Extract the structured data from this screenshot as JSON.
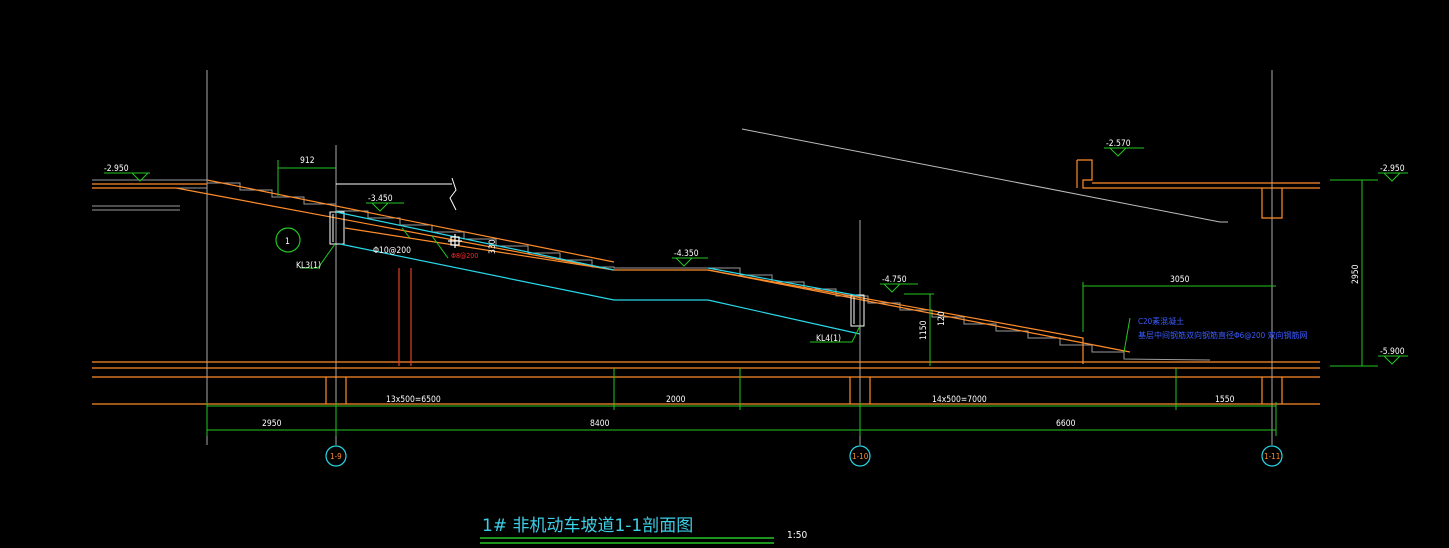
{
  "drawing": {
    "title": "1# 非机动车坡道1-1剖面图",
    "scale": "1:50",
    "elevations": {
      "left_top": "-2.950",
      "mid_upper": "-3.450",
      "mid_landing": "-4.350",
      "right_lower": "-4.750",
      "right_top_slab": "-2.570",
      "right_top": "-2.950",
      "right_bottom": "-5.900"
    },
    "dimensions": {
      "d912": "912",
      "d2950_vert": "2950",
      "d3050": "3050",
      "d1150": "1150",
      "d120": "120",
      "d330": "330",
      "steps_left": "13x500=6500",
      "landing": "2000",
      "steps_right": "14x500=7000",
      "d1550": "1550",
      "bay_left": "2950",
      "bay_mid": "8400",
      "bay_right": "6600"
    },
    "beams": {
      "kl3": "KL3(1)",
      "kl4": "KL4(1)"
    },
    "rebar": {
      "r1": "Φ10@200",
      "r2": "Φ8@200"
    },
    "notes": {
      "line1": "C20素混凝土",
      "line2": "基层中间钢筋双向钢筋直径Φ6@200 双向钢筋网"
    },
    "section_mark": "1",
    "axes": {
      "a1": "1-9",
      "a2": "1-10",
      "a3": "1-11"
    }
  }
}
